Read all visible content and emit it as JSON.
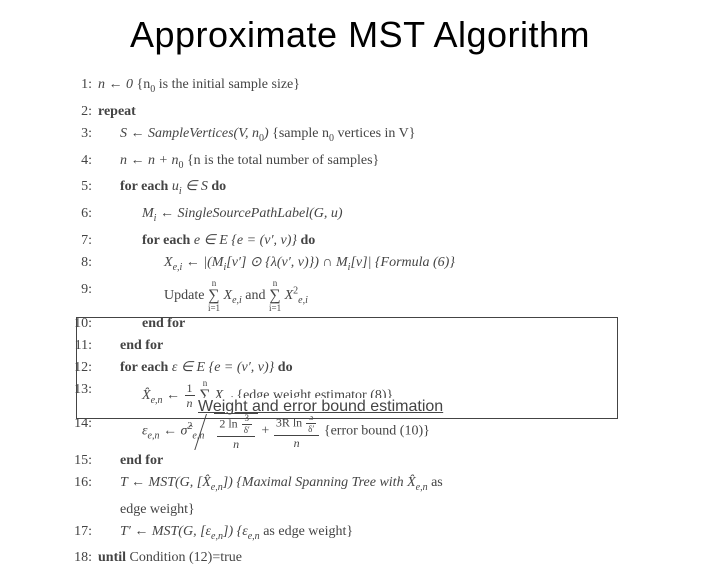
{
  "title": "Approximate MST Algorithm",
  "annotation": "Weight and error bound estimation",
  "lines": {
    "n1": "1:",
    "l1a": "n ← 0",
    "l1b": "{n",
    "l1c": " is the initial sample size}",
    "n2": "2:",
    "l2": "repeat",
    "n3": "3:",
    "l3a": "S ← SampleVertices(V, n",
    "l3b": ")",
    "l3c": " {sample n",
    "l3d": " vertices in V}",
    "n4": "4:",
    "l4a": "n ← n + n",
    "l4b": " {n is the total number of samples}",
    "n5": "5:",
    "l5a": "for each ",
    "l5b": "u",
    "l5c": " ∈ S",
    "l5d": " do",
    "n6": "6:",
    "l6": "M",
    "l6b": " ← SingleSourcePathLabel(G, u)",
    "n7": "7:",
    "l7a": "for each ",
    "l7b": "e ∈ E {e = (v′, v)}",
    "l7c": " do",
    "n8": "8:",
    "l8a": "X",
    "l8b": " ← |(M",
    "l8c": "[v′] ⊙ {λ(v′, v)}) ∩ M",
    "l8d": "[v]|  {Formula (6)}",
    "n9": "9:",
    "l9a": "Update ",
    "l9b": " X",
    "l9c": " and ",
    "l9d": " X",
    "n10": "10:",
    "l10": "end for",
    "n11": "11:",
    "l11": "end for",
    "n12": "12:",
    "l12a": "for each ",
    "l12b": "ε ∈ E {e = (v′, v)}",
    "l12c": " do",
    "n13": "13:",
    "l13a": "X̂",
    "l13b": " ← ",
    "l13c": " X",
    "l13d": " {edge weight estimator (8)}",
    "n14": "14:",
    "l14a": "ε",
    "l14b": " ← σ̂",
    "l14c": " + ",
    "l14d": "  {error bound (10)}",
    "n15": "15:",
    "l15": "end for",
    "n16": "16:",
    "l16a": "T ← MST(G, [X̂",
    "l16b": "])  {Maximal Spanning Tree with X̂",
    "l16c": " as",
    "l16d": "edge weight}",
    "n17": "17:",
    "l17a": "T′ ← MST(G, [ε",
    "l17b": "])  {ε",
    "l17c": " as edge weight}",
    "n18": "18:",
    "l18a": "until ",
    "l18b": "Condition (12)=true"
  },
  "frac": {
    "one": "1",
    "nn": "n",
    "twoln": "2 ln",
    "three": "3",
    "dp": "δ′",
    "threeR": "3R ln"
  },
  "chart_data": {
    "type": "table",
    "description": "Pseudocode listing of an approximate MST algorithm with 18 numbered lines",
    "line_numbers": [
      1,
      2,
      3,
      4,
      5,
      6,
      7,
      8,
      9,
      10,
      11,
      12,
      13,
      14,
      15,
      16,
      17,
      18
    ],
    "annotation_box": {
      "covers_lines": [
        12,
        13,
        14,
        15
      ],
      "label": "Weight and error bound estimation"
    }
  }
}
